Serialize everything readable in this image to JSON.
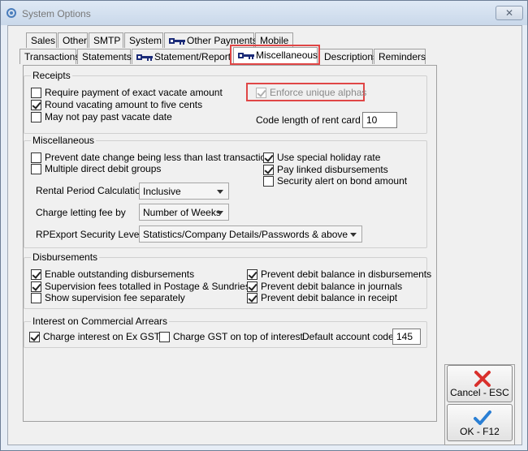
{
  "window": {
    "title": "System Options"
  },
  "tabs_row1": [
    {
      "label": "Sales",
      "icon": null
    },
    {
      "label": "Other",
      "icon": null
    },
    {
      "label": "SMTP",
      "icon": null
    },
    {
      "label": "System",
      "icon": null
    },
    {
      "label": "Other Payments",
      "icon": "key-icon"
    },
    {
      "label": "Mobile",
      "icon": null
    }
  ],
  "tabs_row2": [
    {
      "label": "Transactions",
      "icon": null
    },
    {
      "label": "Statements",
      "icon": null
    },
    {
      "label": "Statement/Report",
      "icon": "key-icon"
    },
    {
      "label": "Miscellaneous",
      "icon": "key-icon",
      "active": true
    },
    {
      "label": "Descriptions",
      "icon": null
    },
    {
      "label": "Reminders",
      "icon": null
    }
  ],
  "receipts": {
    "title": "Receipts",
    "require_exact": {
      "label": "Require payment of exact vacate amount",
      "checked": false
    },
    "round_vacating": {
      "label": "Round vacating amount to five cents",
      "checked": true
    },
    "may_not_pay": {
      "label": "May not pay past vacate date",
      "checked": false
    },
    "enforce_alphas": {
      "label": "Enforce unique alphas",
      "checked": true,
      "disabled": true
    },
    "code_length_label": "Code length of rent card",
    "code_length_value": "10"
  },
  "misc": {
    "title": "Miscellaneous",
    "prevent_date_change": {
      "label": "Prevent date change being less than last transaction",
      "checked": false
    },
    "multiple_dd": {
      "label": "Multiple direct debit groups",
      "checked": false
    },
    "use_special_holiday": {
      "label": "Use special holiday rate",
      "checked": true
    },
    "pay_linked": {
      "label": "Pay linked disbursements",
      "checked": true
    },
    "security_alert": {
      "label": "Security alert on bond amount",
      "checked": false
    },
    "rental_period_label": "Rental Period Calculation",
    "rental_period_value": "Inclusive",
    "letting_fee_label": "Charge letting fee by",
    "letting_fee_value": "Number of Weeks",
    "rpexport_label": "RPExport Security Level",
    "rpexport_value": "Statistics/Company Details/Passwords & above"
  },
  "disb": {
    "title": "Disbursements",
    "enable_outstanding": {
      "label": "Enable outstanding disbursements",
      "checked": true
    },
    "supervision_totalled": {
      "label": "Supervision fees totalled in Postage & Sundries",
      "checked": true
    },
    "show_supervision": {
      "label": "Show supervision fee separately",
      "checked": false
    },
    "prevent_debit_disb": {
      "label": "Prevent debit balance in disbursements",
      "checked": true
    },
    "prevent_debit_journals": {
      "label": "Prevent debit balance in journals",
      "checked": true
    },
    "prevent_debit_receipt": {
      "label": "Prevent debit balance in receipt",
      "checked": true
    }
  },
  "interest": {
    "title": "Interest on Commercial Arrears",
    "charge_ex_gst": {
      "label": "Charge interest on Ex GST",
      "checked": true
    },
    "charge_gst_top": {
      "label": "Charge GST on top of interest",
      "checked": false
    },
    "default_account_label": "Default account code",
    "default_account_value": "145"
  },
  "buttons": {
    "cancel_label": "Cancel - ESC",
    "ok_label": "OK - F12"
  },
  "colors": {
    "highlight": "#e04646",
    "cancel_icon": "#d9302c",
    "ok_icon": "#2a7fd4"
  }
}
